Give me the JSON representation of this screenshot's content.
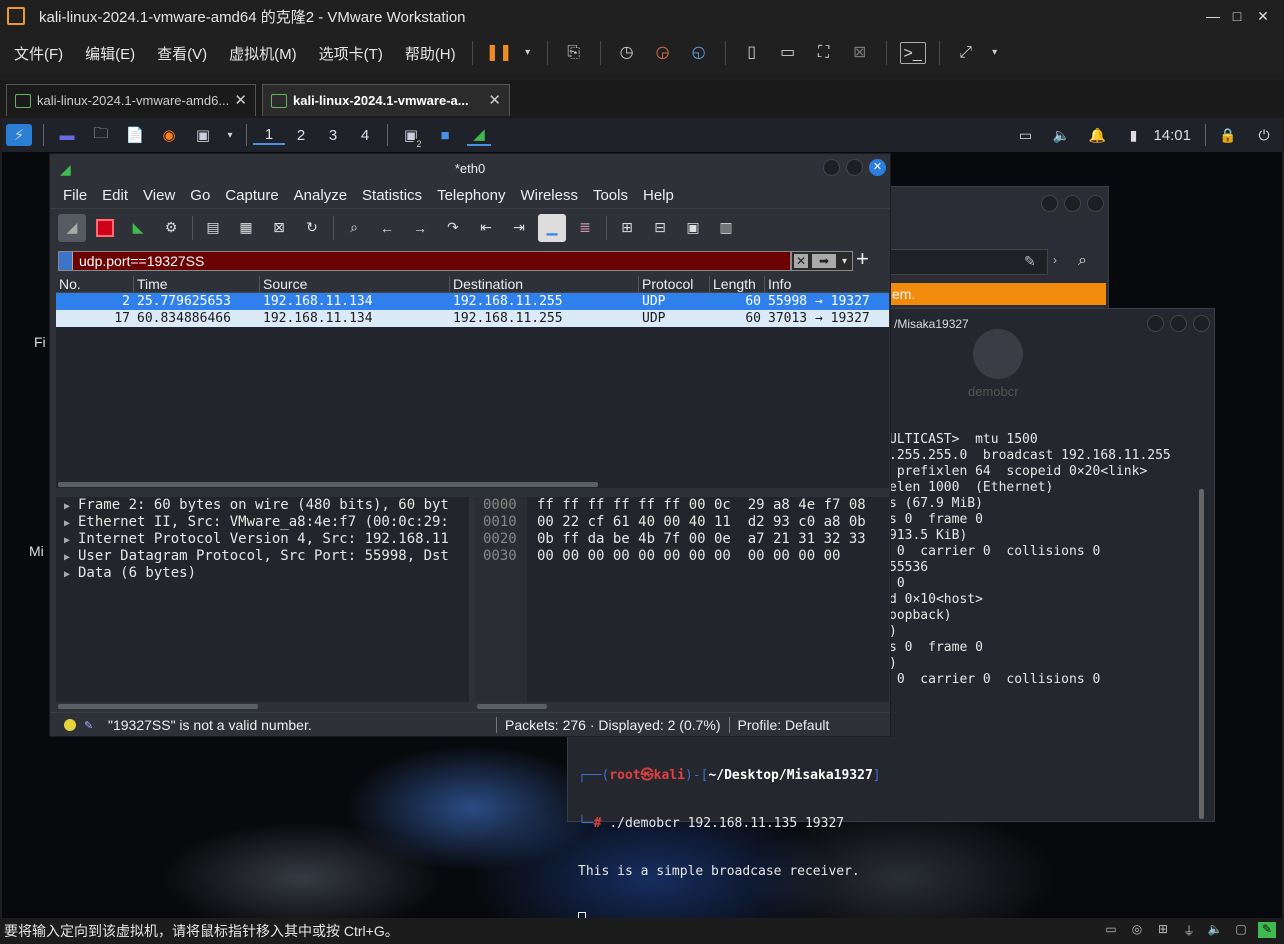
{
  "window": {
    "title": "kali-linux-2024.1-vmware-amd64 的克隆2 - VMware Workstation",
    "controls": {
      "minimize": "—",
      "maximize": "□",
      "close": "✕"
    }
  },
  "vm_menu": [
    "文件(F)",
    "编辑(E)",
    "查看(V)",
    "虚拟机(M)",
    "选项卡(T)",
    "帮助(H)"
  ],
  "vm_tabs": [
    {
      "label": "kali-linux-2024.1-vmware-amd6...",
      "active": false
    },
    {
      "label": "kali-linux-2024.1-vmware-a...",
      "active": true
    }
  ],
  "panel": {
    "workspaces": [
      "1",
      "2",
      "3",
      "4"
    ],
    "terminal_badge": "2",
    "clock": "14:01"
  },
  "desktop_labels": [
    "Fi",
    "Mi"
  ],
  "wireshark": {
    "title": "*eth0",
    "menu": [
      "File",
      "Edit",
      "View",
      "Go",
      "Capture",
      "Analyze",
      "Statistics",
      "Telephony",
      "Wireless",
      "Tools",
      "Help"
    ],
    "filter": {
      "value": "udp.port==19327SS",
      "clear": "✕",
      "apply": "➡",
      "dropdown": "▾",
      "add": "+"
    },
    "columns": [
      "No.",
      "Time",
      "Source",
      "Destination",
      "Protocol",
      "Length",
      "Info"
    ],
    "packets": [
      {
        "no": "2",
        "time": "25.779625653",
        "source": "192.168.11.134",
        "destination": "192.168.11.255",
        "protocol": "UDP",
        "length": "60",
        "info": "55998 → 19327"
      },
      {
        "no": "17",
        "time": "60.834886466",
        "source": "192.168.11.134",
        "destination": "192.168.11.255",
        "protocol": "UDP",
        "length": "60",
        "info": "37013 → 19327"
      }
    ],
    "details": [
      "Frame 2: 60 bytes on wire (480 bits), 60 byt",
      "Ethernet II, Src: VMware_a8:4e:f7 (00:0c:29:",
      "Internet Protocol Version 4, Src: 192.168.11",
      "User Datagram Protocol, Src Port: 55998, Dst",
      "Data (6 bytes)"
    ],
    "hex_offsets": [
      "0000",
      "0010",
      "0020",
      "0030"
    ],
    "hex_bytes": [
      "ff ff ff ff ff ff 00 0c  29 a8 4e f7 08",
      "00 22 cf 61 40 00 40 11  d2 93 c0 a8 0b",
      "0b ff da be 4b 7f 00 0e  a7 21 31 32 33",
      "00 00 00 00 00 00 00 00  00 00 00 00"
    ],
    "status": {
      "message": "\"19327SS\" is not a valid number.",
      "packets": "Packets: 276 · Displayed: 2 (0.7%)",
      "profile": "Profile: Default"
    }
  },
  "bg_window_a": {
    "banner": "em."
  },
  "bg_window_b": {
    "title": "/Misaka19327",
    "icon_label": "demobcr",
    "lines": [
      "ULTICAST>  mtu 1500",
      ".255.255.0  broadcast 192.168.11.255",
      " prefixlen 64  scopeid 0×20<link>",
      "elen 1000  (Ethernet)",
      "s (67.9 MiB)",
      "s 0  frame 0",
      "913.5 KiB)",
      " 0  carrier 0  collisions 0",
      "",
      "55536",
      " 0",
      "d 0×10<host>",
      "oopback)",
      ")",
      "s 0  frame 0",
      ")",
      " 0  carrier 0  collisions 0"
    ]
  },
  "terminal": {
    "prompt_user": "root㉿kali",
    "prompt_path": "~/Desktop/Misaka19327",
    "command": "./demobcr 192.168.11.135 19327",
    "output": "This is a simple broadcase receiver."
  },
  "vm_status": "要将输入定向到该虚拟机，请将鼠标指针移入其中或按 Ctrl+G。",
  "colors": {
    "accent": "#2f80ed",
    "filter_invalid": "#6b0000",
    "orange_banner": "#f28a0b"
  }
}
